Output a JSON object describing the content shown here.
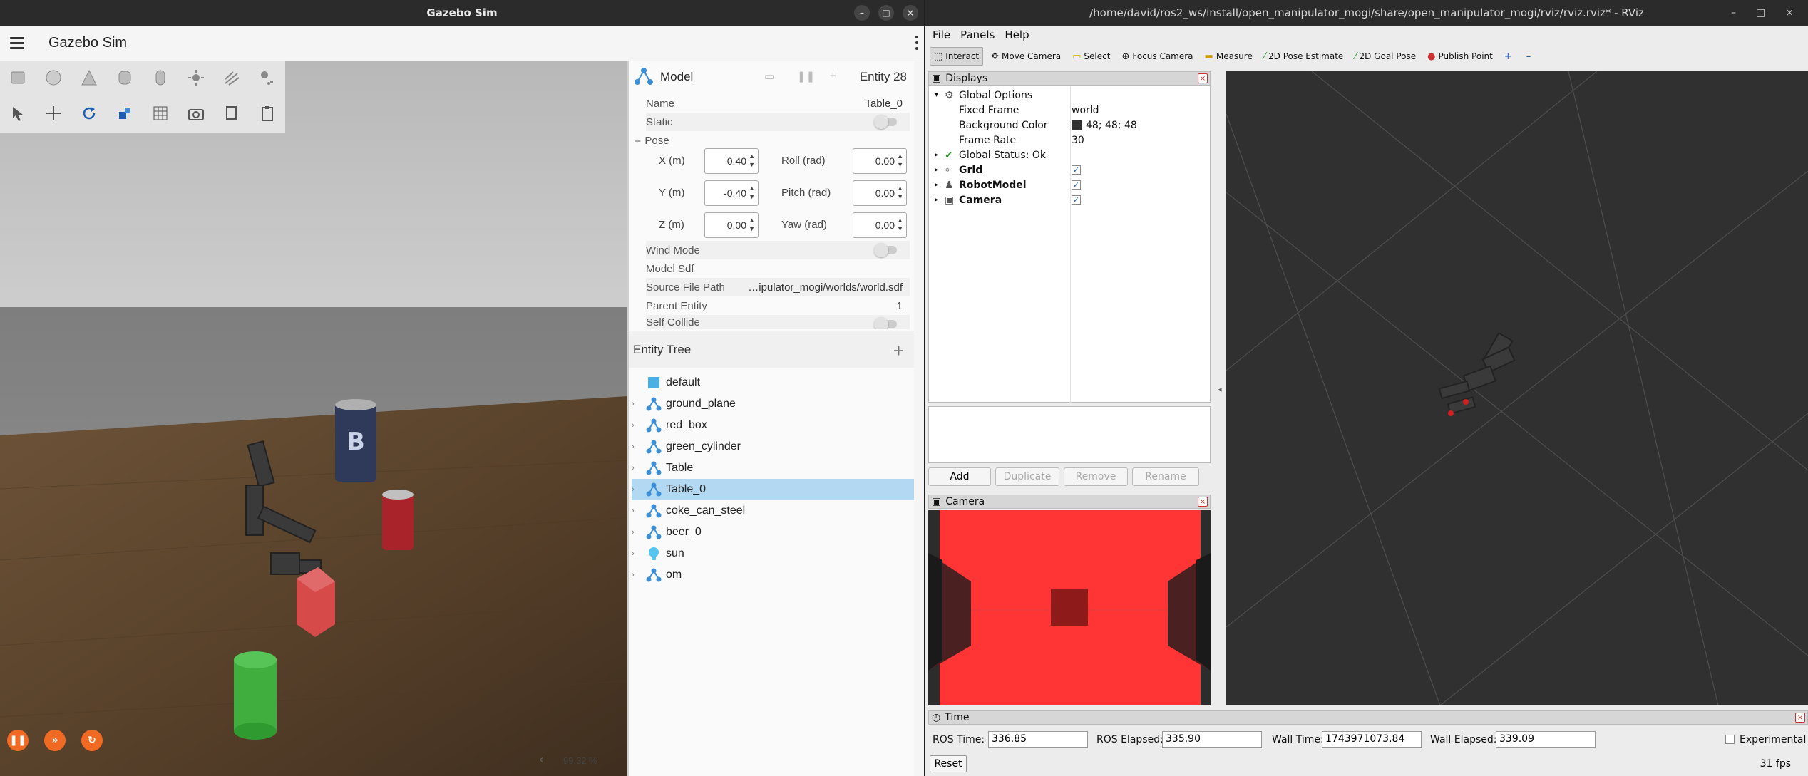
{
  "gazebo": {
    "window_title": "Gazebo Sim",
    "app_title": "Gazebo Sim",
    "zoom": "99.32 %",
    "component": {
      "title": "Model",
      "entity": "Entity 28",
      "name_label": "Name",
      "name_value": "Table_0",
      "static_label": "Static",
      "pose_label": "Pose",
      "x_label": "X (m)",
      "x_value": "0.40",
      "y_label": "Y (m)",
      "y_value": "-0.40",
      "z_label": "Z (m)",
      "z_value": "0.00",
      "roll_label": "Roll (rad)",
      "roll_value": "0.00",
      "pitch_label": "Pitch (rad)",
      "pitch_value": "0.00",
      "yaw_label": "Yaw (rad)",
      "yaw_value": "0.00",
      "wind_label": "Wind Mode",
      "sdf_label": "Model Sdf",
      "src_label": "Source File Path",
      "src_value": "…ipulator_mogi/worlds/world.sdf",
      "parent_label": "Parent Entity",
      "parent_value": "1",
      "collide_label": "Self Collide"
    },
    "tree": {
      "title": "Entity Tree",
      "items": [
        "default",
        "ground_plane",
        "red_box",
        "green_cylinder",
        "Table",
        "Table_0",
        "coke_can_steel",
        "beer_0",
        "sun",
        "om"
      ]
    }
  },
  "rviz": {
    "window_title": "/home/david/ros2_ws/install/open_manipulator_mogi/share/open_manipulator_mogi/rviz/rviz.rviz* - RViz",
    "menu": [
      "File",
      "Panels",
      "Help"
    ],
    "tools": [
      "Interact",
      "Move Camera",
      "Select",
      "Focus Camera",
      "Measure",
      "2D Pose Estimate",
      "2D Goal Pose",
      "Publish Point"
    ],
    "displays": {
      "title": "Displays",
      "global_options": "Global Options",
      "fixed_frame_label": "Fixed Frame",
      "fixed_frame_value": "world",
      "bg_label": "Background Color",
      "bg_value": "48; 48; 48",
      "rate_label": "Frame Rate",
      "rate_value": "30",
      "status": "Global Status: Ok",
      "grid": "Grid",
      "robot": "RobotModel",
      "camera": "Camera"
    },
    "buttons": [
      "Add",
      "Duplicate",
      "Remove",
      "Rename"
    ],
    "camera_panel": "Camera",
    "time": {
      "title": "Time",
      "ros_time_label": "ROS Time:",
      "ros_time": "336.85",
      "ros_elapsed_label": "ROS Elapsed:",
      "ros_elapsed": "335.90",
      "wall_time_label": "Wall Time:",
      "wall_time": "1743971073.84",
      "wall_elapsed_label": "Wall Elapsed:",
      "wall_elapsed": "339.09",
      "experimental": "Experimental",
      "reset": "Reset",
      "fps": "31 fps"
    }
  }
}
